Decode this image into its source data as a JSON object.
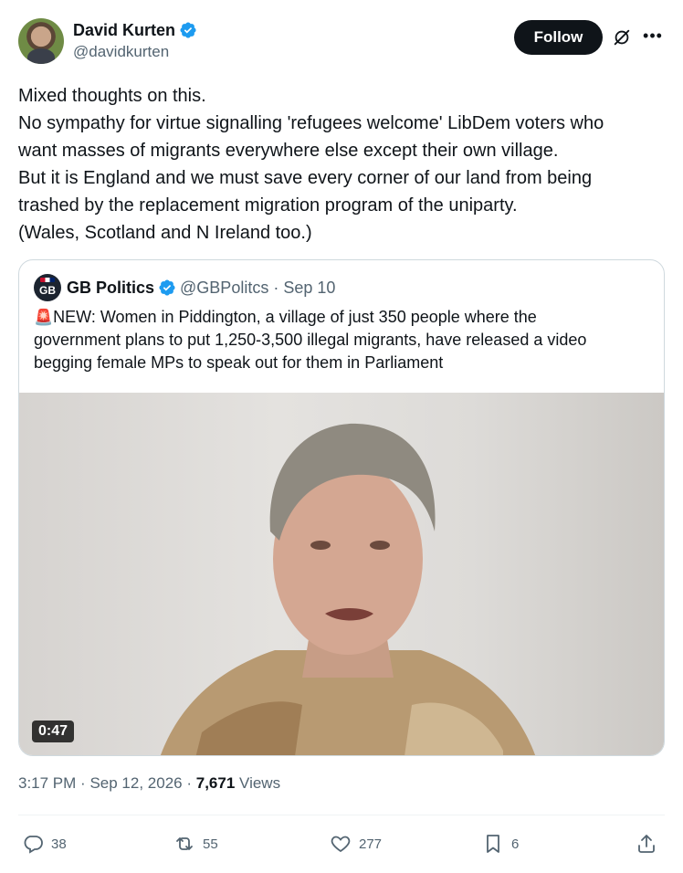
{
  "author": {
    "display_name": "David Kurten",
    "handle": "@davidkurten"
  },
  "header": {
    "follow_label": "Follow"
  },
  "tweet": {
    "lines": [
      "Mixed thoughts on this.",
      "No sympathy for virtue signalling 'refugees welcome' LibDem voters who",
      "want masses of migrants everywhere else except their own village.",
      "But it is England and we must save every corner of our land from being",
      "trashed by the replacement migration program of the uniparty.",
      "(Wales, Scotland and N Ireland too.)"
    ]
  },
  "quote": {
    "logo_text": "GB",
    "display_name": "GB Politics",
    "handle": "@GBPolitcs",
    "separator": "·",
    "date": "Sep 10",
    "siren": "🚨",
    "lines": [
      "NEW: Women in Piddington, a village of just 350 people where the",
      "government plans to put 1,250-3,500 illegal migrants, have released a video",
      "begging female MPs to speak out for them in Parliament"
    ],
    "video_duration": "0:47"
  },
  "meta": {
    "time": "3:17 PM",
    "sep1": "·",
    "date": "Sep 12, 2026",
    "sep2": "·",
    "views_count": "7,671",
    "views_label": "Views"
  },
  "actions": {
    "replies": "38",
    "reposts": "55",
    "likes": "277",
    "bookmarks": "6"
  },
  "colors": {
    "verified": "#1d9bf0",
    "text": "#0f1419",
    "secondary": "#536471",
    "border": "#cfd9de"
  },
  "icons": [
    "verified-badge-icon",
    "grok-icon",
    "more-icon",
    "reply-icon",
    "repost-icon",
    "like-icon",
    "bookmark-icon",
    "share-icon"
  ]
}
